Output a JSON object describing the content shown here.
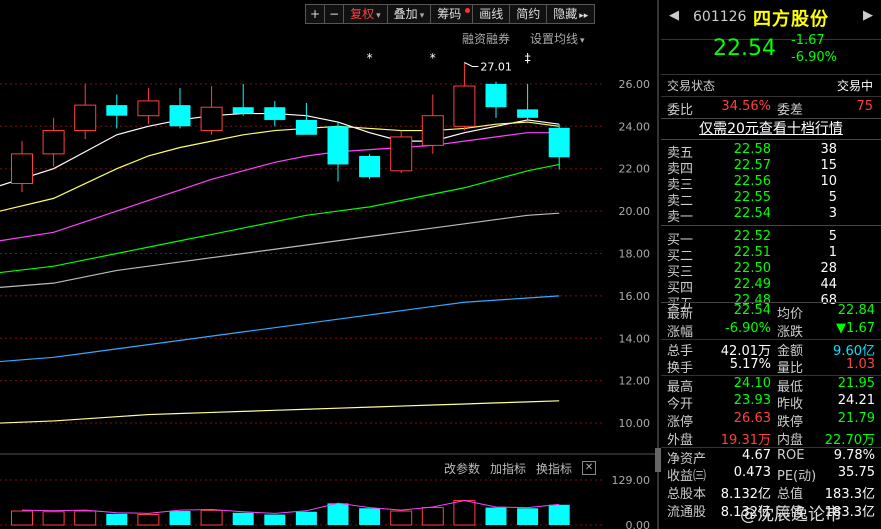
{
  "toolbar": {
    "plus": "+",
    "minus": "−",
    "fuquan": "复权",
    "diejia": "叠加",
    "chouma": "筹码",
    "huaxian": "画线",
    "jianyue": "简约",
    "yincang": "隐藏",
    "more": "▸▸",
    "caret": "▾"
  },
  "subbar": {
    "margin": "融资融券",
    "ma_setting": "设置均线"
  },
  "indicator_bar": {
    "change_param": "改参数",
    "add_ind": "加指标",
    "switch_ind": "换指标",
    "close": "✕"
  },
  "header": {
    "prev": "◀",
    "next": "▶",
    "code": "601126",
    "name": "四方股份",
    "price": "22.54",
    "change": "-1.67",
    "change_pct": "-6.90%"
  },
  "status": {
    "label": "交易状态",
    "value": "交易中"
  },
  "weibi": {
    "label": "委比",
    "value": "34.56%",
    "diff_label": "委差",
    "diff_value": "75"
  },
  "ten_level": "仅需20元查看十档行情",
  "asks": [
    {
      "label": "卖五",
      "price": "22.58",
      "vol": "38"
    },
    {
      "label": "卖四",
      "price": "22.57",
      "vol": "15"
    },
    {
      "label": "卖三",
      "price": "22.56",
      "vol": "10"
    },
    {
      "label": "卖二",
      "price": "22.55",
      "vol": "5"
    },
    {
      "label": "卖一",
      "price": "22.54",
      "vol": "3"
    }
  ],
  "bids": [
    {
      "label": "买一",
      "price": "22.52",
      "vol": "5"
    },
    {
      "label": "买二",
      "price": "22.51",
      "vol": "1"
    },
    {
      "label": "买三",
      "price": "22.50",
      "vol": "28"
    },
    {
      "label": "买四",
      "price": "22.49",
      "vol": "44"
    },
    {
      "label": "买五",
      "price": "22.48",
      "vol": "68"
    }
  ],
  "stats": [
    {
      "l1": "最新",
      "v1": "22.54",
      "c1": "g",
      "l2": "均价",
      "v2": "22.84",
      "c2": "g"
    },
    {
      "l1": "涨幅",
      "v1": "-6.90%",
      "c1": "g",
      "l2": "涨跌",
      "v2": "▼1.67",
      "c2": "g"
    },
    {
      "l1": "总手",
      "v1": "42.01万",
      "c1": "w",
      "l2": "金额",
      "v2": "9.60亿",
      "c2": "c"
    },
    {
      "l1": "换手",
      "v1": "5.17%",
      "c1": "w",
      "l2": "量比",
      "v2": "1.03",
      "c2": "r"
    },
    {
      "l1": "最高",
      "v1": "24.10",
      "c1": "g",
      "l2": "最低",
      "v2": "21.95",
      "c2": "g"
    },
    {
      "l1": "今开",
      "v1": "23.93",
      "c1": "g",
      "l2": "昨收",
      "v2": "24.21",
      "c2": "w"
    },
    {
      "l1": "涨停",
      "v1": "26.63",
      "c1": "r",
      "l2": "跌停",
      "v2": "21.79",
      "c2": "g"
    },
    {
      "l1": "外盘",
      "v1": "19.31万",
      "c1": "r",
      "l2": "内盘",
      "v2": "22.70万",
      "c2": "g"
    },
    {
      "l1": "净资产",
      "v1": "4.67",
      "c1": "w",
      "l2": "ROE",
      "v2": "9.78%",
      "c2": "w"
    },
    {
      "l1": "收益㈢",
      "v1": "0.473",
      "c1": "w",
      "l2": "PE(动)",
      "v2": "35.75",
      "c2": "w"
    },
    {
      "l1": "总股本",
      "v1": "8.132亿",
      "c1": "w",
      "l2": "总值",
      "v2": "183.3亿",
      "c2": "w"
    },
    {
      "l1": "流通股",
      "v1": "8.132亿",
      "c1": "w",
      "l2": "流值",
      "v2": "183.3亿",
      "c2": "w"
    }
  ],
  "watermark": "@沈辰逸论市",
  "chart_data": {
    "type": "candlestick",
    "y_ticks": [
      "26.00",
      "24.00",
      "22.00",
      "20.00",
      "18.00",
      "16.00",
      "14.00",
      "12.00",
      "10.00"
    ],
    "ylim": [
      9.2,
      27.6
    ],
    "high_label": "27.01",
    "markers": [
      "*",
      "*",
      "‡"
    ],
    "candles": [
      {
        "o": 21.3,
        "h": 23.3,
        "l": 20.9,
        "c": 22.7
      },
      {
        "o": 22.7,
        "h": 24.4,
        "l": 22.1,
        "c": 23.8
      },
      {
        "o": 23.8,
        "h": 26.0,
        "l": 23.4,
        "c": 25.0
      },
      {
        "o": 25.0,
        "h": 25.5,
        "l": 23.9,
        "c": 24.5
      },
      {
        "o": 24.5,
        "h": 25.8,
        "l": 24.1,
        "c": 25.2
      },
      {
        "o": 25.0,
        "h": 25.8,
        "l": 23.9,
        "c": 24.0
      },
      {
        "o": 23.8,
        "h": 25.9,
        "l": 23.6,
        "c": 24.9
      },
      {
        "o": 24.9,
        "h": 26.0,
        "l": 24.5,
        "c": 24.6
      },
      {
        "o": 24.9,
        "h": 25.2,
        "l": 24.0,
        "c": 24.3
      },
      {
        "o": 24.3,
        "h": 25.1,
        "l": 23.7,
        "c": 23.6
      },
      {
        "o": 24.0,
        "h": 24.2,
        "l": 21.4,
        "c": 22.2
      },
      {
        "o": 22.6,
        "h": 22.7,
        "l": 21.5,
        "c": 21.6
      },
      {
        "o": 21.9,
        "h": 23.8,
        "l": 21.8,
        "c": 23.5
      },
      {
        "o": 23.1,
        "h": 25.5,
        "l": 22.7,
        "c": 24.5
      },
      {
        "o": 24.0,
        "h": 27.01,
        "l": 23.8,
        "c": 25.9
      },
      {
        "o": 26.0,
        "h": 26.1,
        "l": 24.4,
        "c": 24.9
      },
      {
        "o": 24.8,
        "h": 26.0,
        "l": 24.3,
        "c": 24.4
      },
      {
        "o": 23.93,
        "h": 24.1,
        "l": 21.95,
        "c": 22.54
      }
    ],
    "moving_averages": [
      {
        "color": "#ffffff",
        "values": [
          21.2,
          22.0,
          22.8,
          23.6,
          24.0,
          24.3,
          24.5,
          24.6,
          24.6,
          24.5,
          24.2,
          23.7,
          23.3,
          23.3,
          23.7,
          24.0,
          24.3,
          24.1
        ]
      },
      {
        "color": "#ffff66",
        "values": [
          20.0,
          20.6,
          21.3,
          22.0,
          22.6,
          23.0,
          23.3,
          23.6,
          23.8,
          23.9,
          24.0,
          23.9,
          23.8,
          23.8,
          23.9,
          24.1,
          24.2,
          24.0
        ]
      },
      {
        "color": "#ff40ff",
        "values": [
          18.6,
          19.0,
          19.5,
          20.0,
          20.5,
          21.0,
          21.5,
          21.9,
          22.3,
          22.6,
          22.8,
          22.9,
          23.0,
          23.1,
          23.3,
          23.5,
          23.7,
          23.7
        ]
      },
      {
        "color": "#00ff00",
        "values": [
          17.1,
          17.4,
          17.7,
          18.0,
          18.3,
          18.6,
          18.9,
          19.2,
          19.5,
          19.8,
          20.0,
          20.2,
          20.5,
          20.8,
          21.1,
          21.5,
          21.9,
          22.2
        ]
      },
      {
        "color": "#bbbbbb",
        "values": [
          16.4,
          16.6,
          16.9,
          17.2,
          17.4,
          17.6,
          17.8,
          18.0,
          18.2,
          18.4,
          18.6,
          18.8,
          19.0,
          19.2,
          19.4,
          19.6,
          19.8,
          19.9
        ]
      },
      {
        "color": "#33aaff",
        "values": [
          12.9,
          13.1,
          13.3,
          13.5,
          13.7,
          13.9,
          14.1,
          14.3,
          14.5,
          14.7,
          14.9,
          15.1,
          15.3,
          15.5,
          15.7,
          15.8,
          15.9,
          16.0
        ]
      },
      {
        "color": "#ffff99",
        "values": [
          10.0,
          10.1,
          10.2,
          10.3,
          10.4,
          10.45,
          10.5,
          10.55,
          10.6,
          10.65,
          10.7,
          10.75,
          10.8,
          10.85,
          10.9,
          10.95,
          11.0,
          11.05
        ]
      }
    ],
    "volume": {
      "ticks": [
        "129.00",
        "0.00"
      ],
      "values": [
        40,
        38,
        40,
        32,
        30,
        40,
        42,
        35,
        30,
        38,
        62,
        48,
        40,
        50,
        70,
        50,
        48,
        58
      ]
    }
  }
}
